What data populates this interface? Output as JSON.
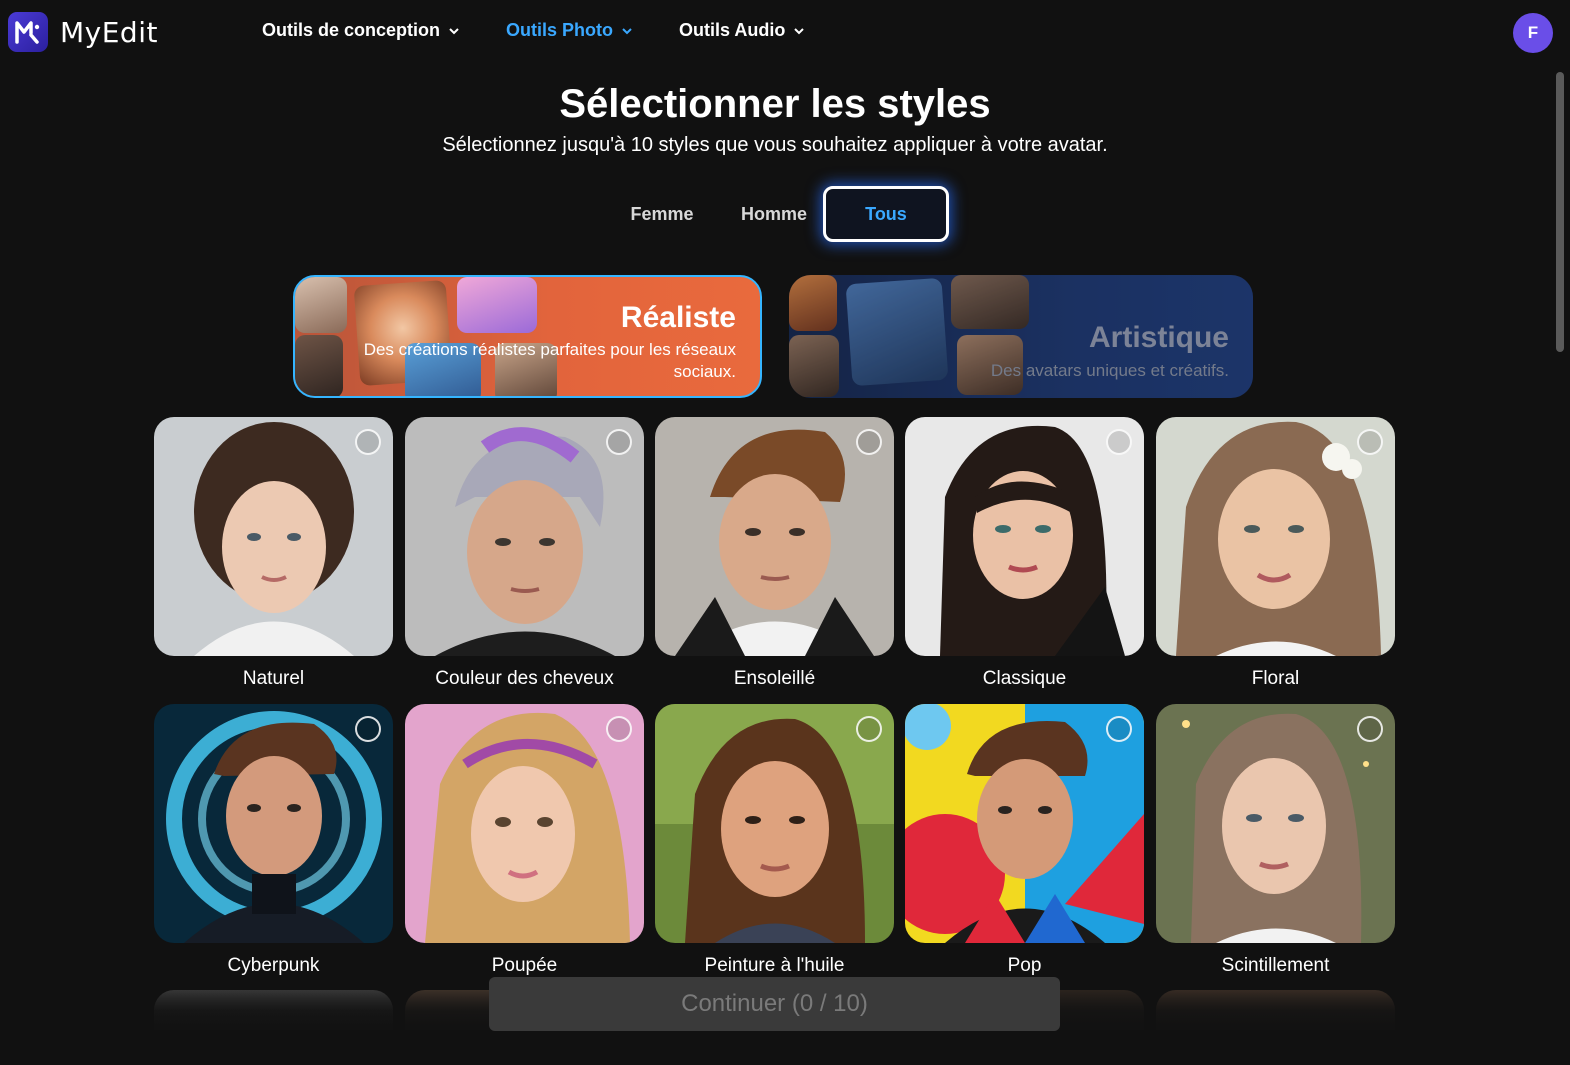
{
  "app": {
    "name": "MyEdit"
  },
  "nav": {
    "items": [
      {
        "label": "Outils de conception",
        "active": false
      },
      {
        "label": "Outils Photo",
        "active": true
      },
      {
        "label": "Outils Audio",
        "active": false
      }
    ],
    "accent": "#3aa8ff"
  },
  "user": {
    "initial": "F",
    "avatar_color": "#6a4ee8"
  },
  "page": {
    "title": "Sélectionner les styles",
    "subtitle": "Sélectionnez jusqu'à 10 styles que vous souhaitez appliquer à votre avatar."
  },
  "tabs": {
    "femme": "Femme",
    "homme": "Homme",
    "tous": "Tous",
    "selected": "Tous"
  },
  "categories": {
    "realiste": {
      "title": "Réaliste",
      "desc": "Des créations réalistes parfaites pour les réseaux sociaux.",
      "selected": true
    },
    "artistique": {
      "title": "Artistique",
      "desc": "Des avatars uniques et créatifs.",
      "selected": false
    }
  },
  "styles": [
    {
      "label": "Naturel",
      "selected": false
    },
    {
      "label": "Couleur des cheveux",
      "selected": false
    },
    {
      "label": "Ensoleillé",
      "selected": false
    },
    {
      "label": "Classique",
      "selected": false
    },
    {
      "label": "Floral",
      "selected": false
    },
    {
      "label": "Cyberpunk",
      "selected": false
    },
    {
      "label": "Poupée",
      "selected": false
    },
    {
      "label": "Peinture à l'huile",
      "selected": false
    },
    {
      "label": "Pop",
      "selected": false
    },
    {
      "label": "Scintillement",
      "selected": false
    }
  ],
  "continue_button": {
    "label": "Continuer (0 / 10)",
    "enabled": false
  }
}
